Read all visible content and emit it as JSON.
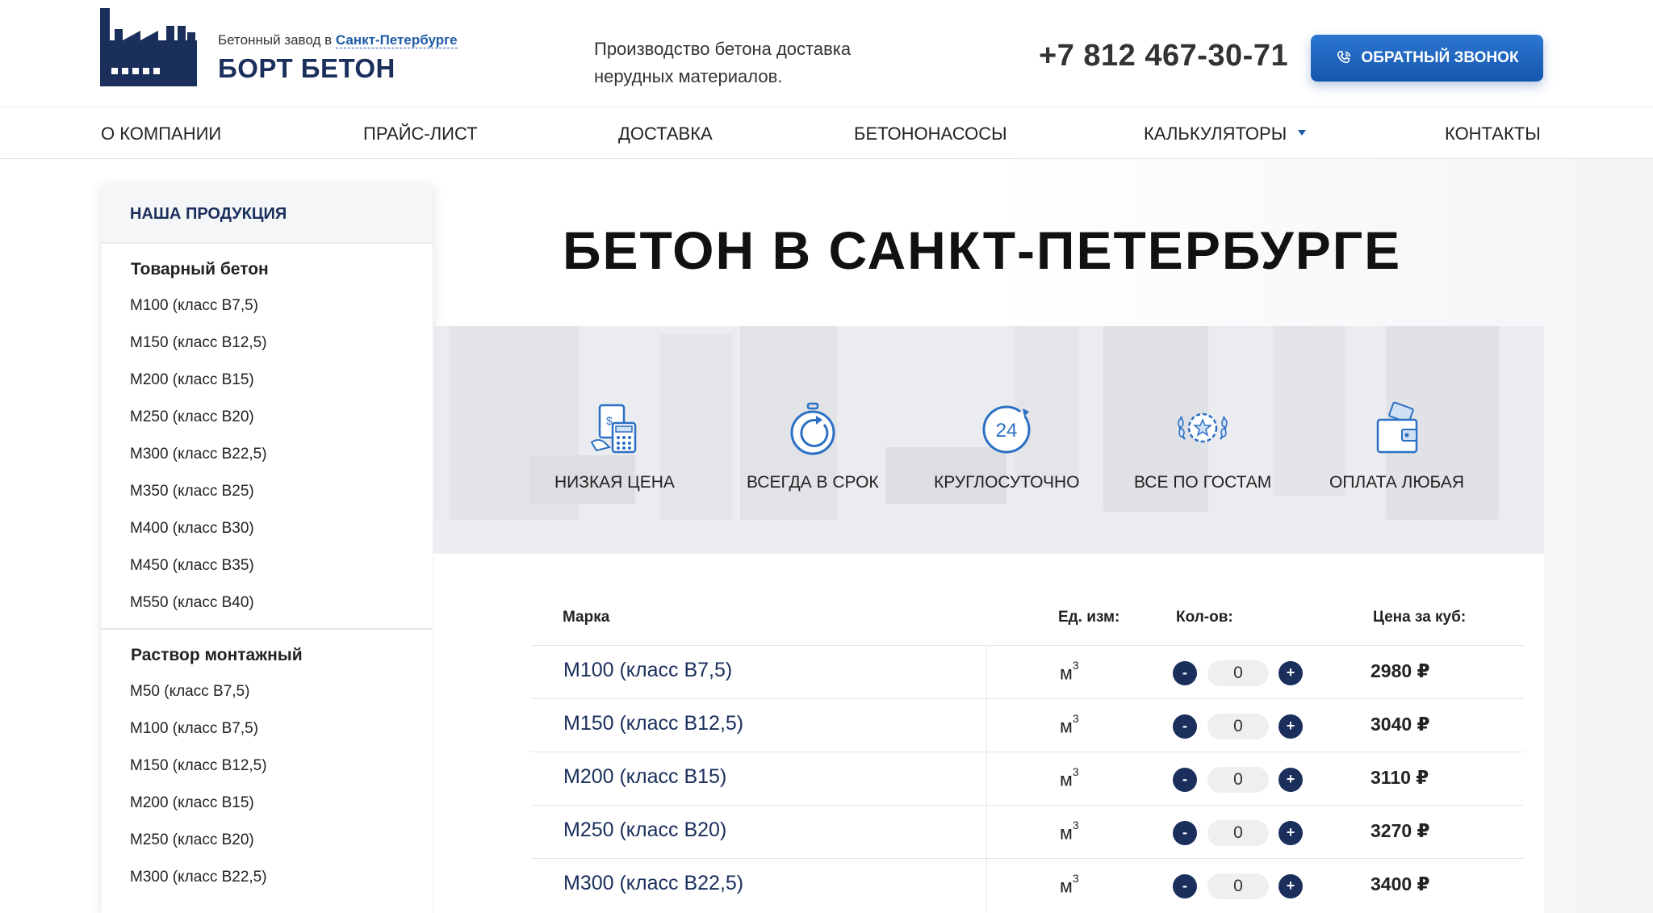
{
  "header": {
    "logo_subtitle": "Бетонный завод в",
    "logo_city": "Санкт-Петербурге",
    "logo_title": "БОРТ БЕТОН",
    "tagline_line1": "Производство бетона доставка",
    "tagline_line2": "нерудных материалов.",
    "phone": "+7 812 467-30-71",
    "callback_label": "ОБРАТНЫЙ ЗВОНОК",
    "accent_color": "#1e5aa8",
    "brand_color": "#1a2f5c"
  },
  "nav": {
    "items": [
      {
        "label": "О КОМПАНИИ"
      },
      {
        "label": "ПРАЙС-ЛИСТ"
      },
      {
        "label": "ДОСТАВКА"
      },
      {
        "label": "БЕТОНОНАСОСЫ"
      },
      {
        "label": "КАЛЬКУЛЯТОРЫ"
      },
      {
        "label": "КОНТАКТЫ"
      }
    ]
  },
  "sidebar": {
    "title": "НАША ПРОДУКЦИЯ",
    "groups": [
      {
        "title": "Товарный бетон",
        "items": [
          "М100 (класс В7,5)",
          "М150 (класс В12,5)",
          "М200 (класс В15)",
          "М250 (класс В20)",
          "М300 (класс В22,5)",
          "М350 (класс В25)",
          "М400 (класс В30)",
          "М450 (класс В35)",
          "М550 (класс В40)"
        ]
      },
      {
        "title": "Раствор монтажный",
        "items": [
          "М50 (класс В7,5)",
          "М100 (класс В7,5)",
          "М150 (класс В12,5)",
          "М200 (класс В15)",
          "М250 (класс В20)",
          "М300 (класс В22,5)"
        ]
      }
    ]
  },
  "main": {
    "title": "БЕТОН В САНКТ-ПЕТЕРБУРГЕ",
    "features": [
      {
        "label": "НИЗКАЯ ЦЕНА",
        "icon": "calculator-icon"
      },
      {
        "label": "ВСЕГДА В СРОК",
        "icon": "stopwatch-icon"
      },
      {
        "label": "КРУГЛОСУТОЧНО",
        "icon": "clock-24-icon"
      },
      {
        "label": "ВСЕ ПО ГОСТАМ",
        "icon": "laurel-badge-icon"
      },
      {
        "label": "ОПЛАТА ЛЮБАЯ",
        "icon": "wallet-icon"
      }
    ],
    "table": {
      "headers": {
        "brand": "Марка",
        "unit": "Ед. изм:",
        "qty": "Кол-ов:",
        "price": "Цена за куб:"
      },
      "rows": [
        {
          "name": "М100 (класс В7,5)",
          "unit": "м",
          "unit_sup": "3",
          "qty": "0",
          "price": "2980 ₽"
        },
        {
          "name": "М150 (класс В12,5)",
          "unit": "м",
          "unit_sup": "3",
          "qty": "0",
          "price": "3040 ₽"
        },
        {
          "name": "М200 (класс В15)",
          "unit": "м",
          "unit_sup": "3",
          "qty": "0",
          "price": "3110 ₽"
        },
        {
          "name": "М250 (класс В20)",
          "unit": "м",
          "unit_sup": "3",
          "qty": "0",
          "price": "3270 ₽"
        },
        {
          "name": "М300 (класс В22,5)",
          "unit": "м",
          "unit_sup": "3",
          "qty": "0",
          "price": "3400 ₽"
        }
      ],
      "minus_label": "-",
      "plus_label": "+"
    }
  }
}
